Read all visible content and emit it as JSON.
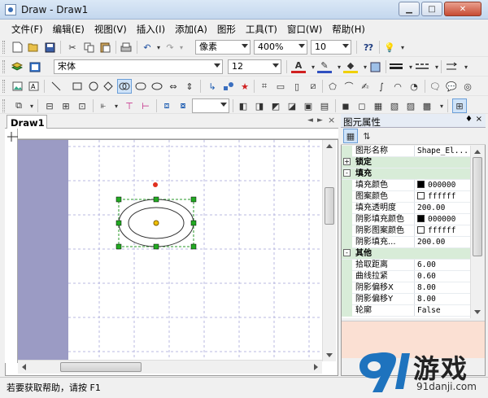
{
  "window": {
    "title": "Draw - Draw1"
  },
  "menu": [
    "文件(F)",
    "编辑(E)",
    "视图(V)",
    "插入(I)",
    "添加(A)",
    "图形",
    "工具(T)",
    "窗口(W)",
    "帮助(H)"
  ],
  "toolbar1": {
    "unit": "像素",
    "zoom": "400%",
    "line_width": "10"
  },
  "toolbar2": {
    "font_name": "宋体",
    "font_size": "12"
  },
  "document": {
    "tab_label": "Draw1",
    "nav_prev": "◄",
    "nav_next": "►",
    "close": "×"
  },
  "properties": {
    "title": "图元属性",
    "pin": "♦",
    "close": "×",
    "rows": [
      {
        "type": "row",
        "key": "图形名称",
        "value": "Shape_El..."
      },
      {
        "type": "cat",
        "key": "锁定",
        "sign": "+"
      },
      {
        "type": "cat",
        "key": "填充",
        "sign": "-"
      },
      {
        "type": "row",
        "key": "填充颜色",
        "value": "000000",
        "swatch": "#000000"
      },
      {
        "type": "row",
        "key": "图案颜色",
        "value": "ffffff",
        "swatch": "#ffffff"
      },
      {
        "type": "row",
        "key": "填充透明度",
        "value": "200.00"
      },
      {
        "type": "row",
        "key": "阴影填充颜色",
        "value": "000000",
        "swatch": "#000000"
      },
      {
        "type": "row",
        "key": "阴影图案颜色",
        "value": "ffffff",
        "swatch": "#ffffff"
      },
      {
        "type": "row",
        "key": "阴影填充...",
        "value": "200.00"
      },
      {
        "type": "cat",
        "key": "其他",
        "sign": "-"
      },
      {
        "type": "row",
        "key": "拾取距离",
        "value": "6.00"
      },
      {
        "type": "row",
        "key": "曲线拉紧",
        "value": "0.60"
      },
      {
        "type": "row",
        "key": "阴影偏移X",
        "value": "8.00"
      },
      {
        "type": "row",
        "key": "阴影偏移Y",
        "value": "8.00"
      },
      {
        "type": "row",
        "key": "轮廓",
        "value": "False"
      }
    ]
  },
  "status": {
    "text": "若要获取帮助，请按 F1"
  },
  "watermark": {
    "brand_text": "游戏",
    "url": "91danji.com"
  },
  "colors": {
    "accent": "#1e73be",
    "strip": "#9b9bc4",
    "category": "#d8ecd8",
    "desc_panel": "#fbe0d3"
  }
}
